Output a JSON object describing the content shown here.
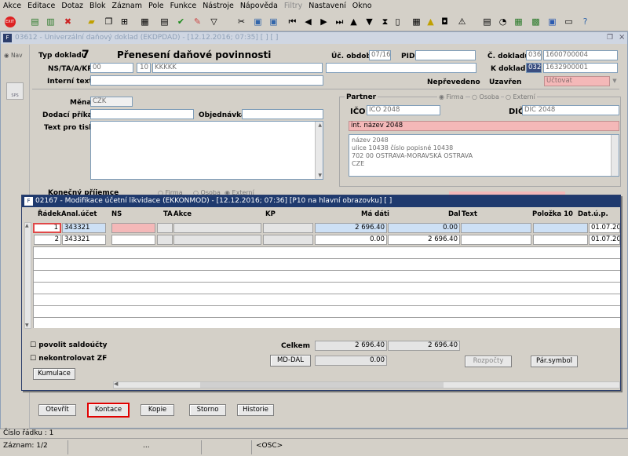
{
  "menu": [
    "Akce",
    "Editace",
    "Dotaz",
    "Blok",
    "Záznam",
    "Pole",
    "Funkce",
    "Nástroje",
    "Nápověda",
    "Filtry",
    "Nastavení",
    "Okno"
  ],
  "window": {
    "title": "03612 - Univerzální daňový doklad (EKDPDAD) - [12.12.2016; 07:35]  [ ] [ ]"
  },
  "sidebar": {
    "nav": "Nav",
    "sps": "SPS"
  },
  "header": {
    "typ_dokladu_label": "Typ dokladu",
    "typ_dokladu": "7",
    "typ_nazev": "Přenesení daňové povinnosti",
    "uc_obdobi_label": "Úč. období",
    "uc_obdobi": "07/16",
    "pid_label": "PID",
    "pid": "",
    "c_dokladu_label": "Č. dokladu",
    "c_dokladu_prefix": "036",
    "c_dokladu": "1600700004",
    "ns_label": "NS/TA/A/KP",
    "ns1": "00",
    "ns2": "10",
    "ns3": "KKKKK",
    "k_dokladu_label": "K dokladu",
    "k_dokladu_prefix": "032",
    "k_dokladu": "1632900001",
    "interni_text_label": "Interní text",
    "neprevedeno_label": "Nepřevedeno",
    "uzavren_label": "Uzavřen",
    "uzavren": "Účtovat",
    "mena_label": "Měna",
    "mena": "CZK",
    "dodaci_label": "Dodací příkaz",
    "objednavka_label": "Objednávka",
    "text_pro_tisk_label": "Text pro tisk",
    "konecny_label": "Konečný příjemce",
    "konecny_opts": [
      "Firma",
      "Osoba",
      "Externí"
    ]
  },
  "partner": {
    "label": "Partner",
    "opts": [
      "Firma",
      "Osoba",
      "Externí"
    ],
    "ico_label": "IČO",
    "ico": "IČO 2048",
    "dic_label": "DIČ",
    "dic": "DIČ 2048",
    "int_nazev": "int. název 2048",
    "address": [
      "název 2048",
      "ulice 10438 číslo popisné 10438",
      "702 00 OSTRAVA-MORAVSKÁ OSTRAVA",
      "CZE"
    ]
  },
  "modal": {
    "title": "02167 - Modifikace účetní likvidace (EKKONMOD) - [12.12.2016; 07:36]  [P10 na hlavní obrazovku]  [ ]",
    "columns": {
      "radek": "Řádek",
      "anal": "Anal.účet",
      "ns": "NS",
      "ta": "TA",
      "akce": "Akce",
      "kp": "KP",
      "ma_dati": "Má dáti",
      "dal": "Dal",
      "text": "Text",
      "polozka": "Položka 10",
      "datup": "Dat.ú.p."
    },
    "rows": [
      {
        "radek": "1",
        "anal": "343321",
        "ma_dati": "2 696.40",
        "dal": "0.00",
        "datup": "01.07.201"
      },
      {
        "radek": "2",
        "anal": "343321",
        "ma_dati": "0.00",
        "dal": "2 696.40",
        "datup": "01.07.201"
      }
    ],
    "povolit_saldoucty": "povolit saldoúčty",
    "nekontrolovat_zf": "nekontrolovat ZF",
    "celkem_label": "Celkem",
    "celkem_ma": "2 696.40",
    "celkem_dal": "2 696.40",
    "md_dal_label": "MD-DAL",
    "md_dal": "0.00",
    "rozpocty": "Rozpočty",
    "par_symbol": "Pár.symbol",
    "kumulace": "Kumulace"
  },
  "buttons": {
    "otevrit": "Otevřít",
    "kontace": "Kontace",
    "kopie": "Kopie",
    "storno": "Storno",
    "historie": "Historie"
  },
  "status": {
    "cislo_radku": "Číslo řádku : 1",
    "zaznam": "Záznam: 1/2",
    "dots": "...",
    "osc": "<OSC>"
  },
  "colors": {
    "title_bar": "#1f3a6e",
    "pink": "#f4b8b8",
    "highlight": "#cde0f5",
    "kontace_border": "#e00000"
  }
}
